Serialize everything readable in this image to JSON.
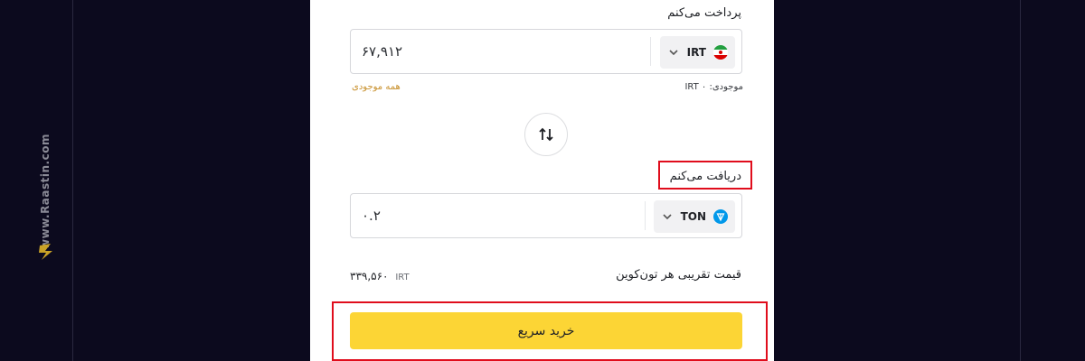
{
  "watermark": {
    "text": "www.Raastin.com"
  },
  "pay": {
    "label": "پرداخت می‌کنم",
    "value": "۶۷,۹۱۲",
    "currency": "IRT",
    "balance_label": "موجودی:",
    "balance_value": "IRT ۰",
    "all_balance": "همه موجودی"
  },
  "receive": {
    "label": "دریافت می‌کنم",
    "value": "۰.۲",
    "currency": "TON"
  },
  "price": {
    "label": "قیمت تقریبی هر تون‌کوین",
    "value": "۳۳۹,۵۶۰",
    "unit": "IRT"
  },
  "buy_button": {
    "label": "خرید سریع"
  },
  "colors": {
    "background": "#0c0a1e",
    "accent": "#fcd535",
    "highlight": "#e00d1c",
    "link": "#c8902c",
    "ton": "#0098ea"
  }
}
